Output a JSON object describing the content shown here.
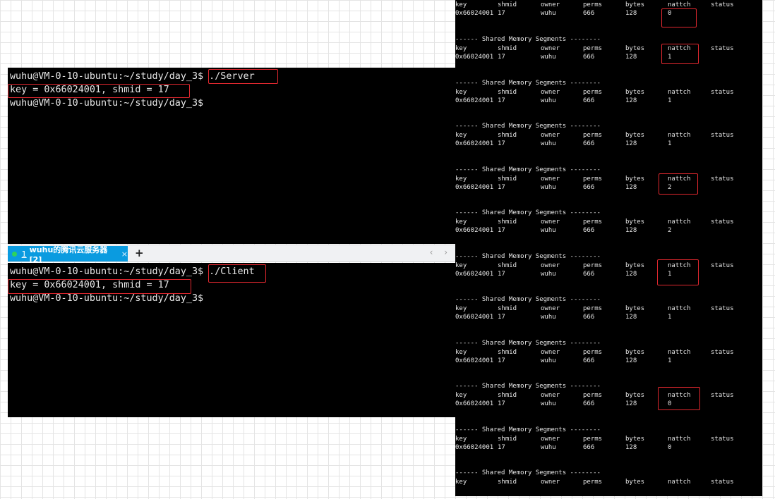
{
  "server_terminal": {
    "line1_prompt": "wuhu@VM-0-10-ubuntu:~/study/day_3$ ",
    "line1_cmd": "./Server",
    "line2": "key = 0x66024001, shmid = 17",
    "line3": "wuhu@VM-0-10-ubuntu:~/study/day_3$"
  },
  "tabbar": {
    "tab_number": "1",
    "tab_title": "wuhu的腾讯云服务器 [2]",
    "close_icon": "×",
    "add_icon": "+",
    "nav_icons": "‹ ›"
  },
  "client_terminal": {
    "line1_prompt": "wuhu@VM-0-10-ubuntu:~/study/day_3$ ",
    "line1_cmd": "./Client",
    "line2": "key = 0x66024001, shmid = 17",
    "line3": "wuhu@VM-0-10-ubuntu:~/study/day_3$"
  },
  "ipcs": {
    "section_title": "------ Shared Memory Segments --------",
    "headers": [
      "key",
      "shmid",
      "owner",
      "perms",
      "bytes",
      "nattch",
      "status"
    ],
    "row_values": {
      "key": "0x66024001",
      "shmid": "17",
      "owner": "wuhu",
      "perms": "666",
      "bytes": "128"
    },
    "first_header_row": [
      "key",
      "shmid",
      "owner",
      "perms",
      "bytes",
      "nattch",
      "status"
    ],
    "nattch_sequence": [
      "0",
      "1",
      "1",
      "1",
      "2",
      "2",
      "1",
      "1",
      "1",
      "0",
      "0"
    ]
  },
  "colors": {
    "highlight": "#e2282f",
    "tab_active": "#0a9be0",
    "tab_dot": "#2fd35a",
    "terminal_bg": "#000000"
  }
}
